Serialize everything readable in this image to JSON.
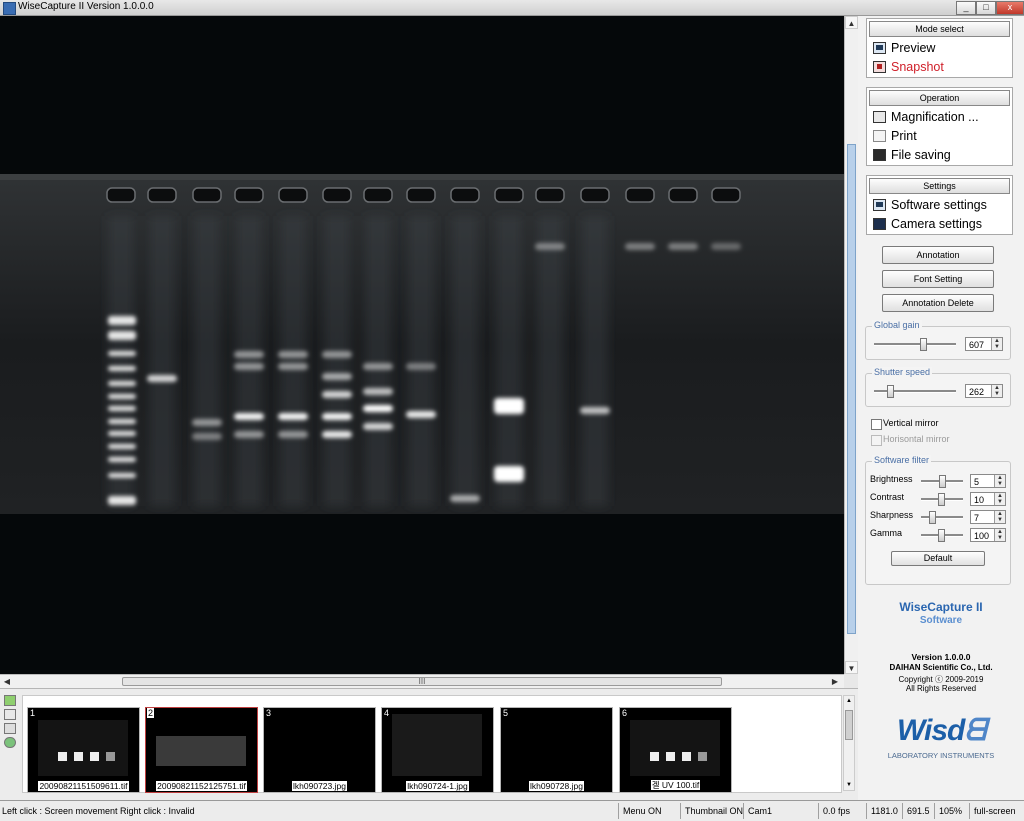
{
  "window": {
    "title": "WiseCapture II  Version 1.0.0.0",
    "minimize_label": "_",
    "maximize_label": "□",
    "close_label": "x"
  },
  "viewer": {
    "description": "gel image",
    "gel_background": "#1b1d1f",
    "band_color": "#ffffff"
  },
  "scroll": {
    "up": "▲",
    "down": "▼",
    "left": "◀",
    "right": "▶",
    "grip": "III"
  },
  "panel": {
    "mode_select": {
      "title": "Mode select",
      "items": [
        {
          "label": "Preview",
          "icon": "monitor-icon"
        },
        {
          "label": "Snapshot",
          "icon": "snapshot-icon",
          "active_color": "#d0202a"
        }
      ]
    },
    "operation": {
      "title": "Operation",
      "items": [
        {
          "label": "Magnification ...",
          "icon": "magnifier-icon"
        },
        {
          "label": "Print",
          "icon": "printer-icon"
        },
        {
          "label": "File saving",
          "icon": "floppy-icon"
        }
      ]
    },
    "settings": {
      "title": "Settings",
      "items": [
        {
          "label": "Software settings",
          "icon": "software-settings-icon"
        },
        {
          "label": "Camera settings",
          "icon": "camera-settings-icon"
        }
      ]
    },
    "buttons": {
      "annotation": "Annotation",
      "font_setting": "Font Setting",
      "annotation_delete": "Annotation Delete"
    },
    "global_gain": {
      "label": "Global gain",
      "value": "607",
      "level": 0.6
    },
    "shutter_speed": {
      "label": "Shutter speed",
      "value": "262",
      "level": 0.2
    },
    "vertical_mirror": "Vertical mirror",
    "horizontal_mirror": "Horisontal mirror",
    "software_filter": {
      "label": "Software filter",
      "rows": [
        {
          "label": "Brightness",
          "value": "5"
        },
        {
          "label": "Contrast",
          "value": "10"
        },
        {
          "label": "Sharpness",
          "value": "7"
        },
        {
          "label": "Gamma",
          "value": "100"
        }
      ],
      "default_label": "Default"
    },
    "brand": {
      "name": "WiseCapture II",
      "sub": "Software",
      "version": "Version 1.0.0.0",
      "company": "DAIHAN Scientific Co., Ltd.",
      "copyright": "Copyright ⓒ 2009-2019",
      "rights": "All Rights Reserved",
      "logo": "Wisd",
      "logo_sub": "LABORATORY INSTRUMENTS",
      "accent": "#1c5fa8"
    }
  },
  "thumbnails": [
    {
      "num": "1",
      "name": "20090821151509611.tif"
    },
    {
      "num": "2",
      "name": "20090821152125751.tif"
    },
    {
      "num": "3",
      "name": "lkh090723.jpg"
    },
    {
      "num": "4",
      "name": "lkh090724-1.jpg"
    },
    {
      "num": "5",
      "name": "lkh090728.jpg"
    },
    {
      "num": "6",
      "name": "겔 UV 100.tif"
    }
  ],
  "status": {
    "hint": "Left click : Screen movement  Right click : Invalid",
    "menu": "Menu ON",
    "thumbnail": "Thumbnail ON",
    "cam": "Cam1",
    "fps": "0.0 fps",
    "x": "1181.0",
    "y": "691.5",
    "zoom": "105%",
    "mode": "full-screen"
  }
}
